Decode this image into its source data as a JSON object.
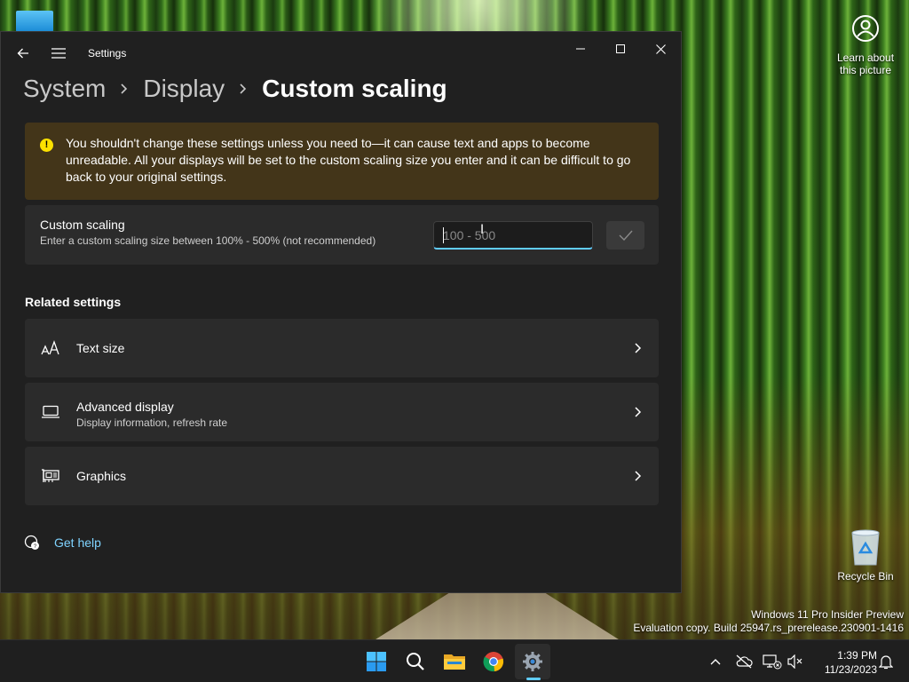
{
  "desktop": {
    "spotlight_label_line1": "Learn about",
    "spotlight_label_line2": "this picture",
    "recycle_bin_label": "Recycle Bin",
    "watermark_line1": "Windows 11 Pro Insider Preview",
    "watermark_line2": "Evaluation copy. Build 25947.rs_prerelease.230901-1416"
  },
  "window": {
    "app_title": "Settings",
    "breadcrumb": [
      "System",
      "Display",
      "Custom scaling"
    ]
  },
  "warning": {
    "text": "You shouldn't change these settings unless you need to—it can cause text and apps to become unreadable. All your displays will be set to the custom scaling size you enter and it can be difficult to go back to your original settings."
  },
  "custom_scaling": {
    "title": "Custom scaling",
    "subtitle": "Enter a custom scaling size between 100% - 500% (not recommended)",
    "input_value": "",
    "input_placeholder": "100 - 500"
  },
  "related": {
    "heading": "Related settings",
    "items": [
      {
        "title": "Text size",
        "subtitle": ""
      },
      {
        "title": "Advanced display",
        "subtitle": "Display information, refresh rate"
      },
      {
        "title": "Graphics",
        "subtitle": ""
      }
    ]
  },
  "help": {
    "label": "Get help"
  },
  "taskbar": {
    "time": "1:39 PM",
    "date": "11/23/2023",
    "apps": [
      "start-icon",
      "search-icon",
      "file-explorer-icon",
      "chrome-icon",
      "settings-icon"
    ]
  },
  "colors": {
    "accent": "#60cdff",
    "window_bg": "#202020",
    "card_bg": "#2b2b2b",
    "warning_bg": "#433519",
    "warning_icon": "#fce100"
  }
}
